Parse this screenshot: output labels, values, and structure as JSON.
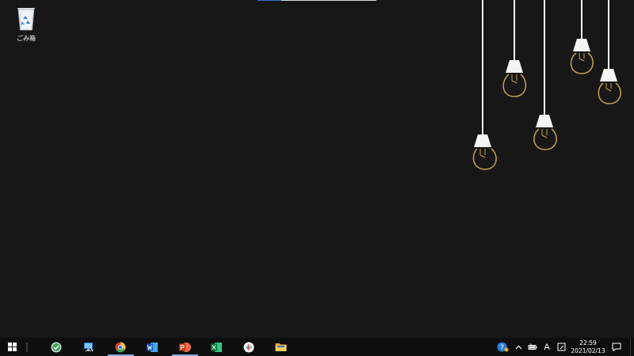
{
  "desktop": {
    "icons": [
      {
        "label": "ごみ箱",
        "icon": "recycle-bin-icon"
      }
    ]
  },
  "taskbar": {
    "start_icon": "windows-start-icon",
    "apps": [
      {
        "name": "Tasks",
        "icon": "green-check-icon",
        "active": false
      },
      {
        "name": "Remote Desktop",
        "icon": "remote-desktop-icon",
        "active": false
      },
      {
        "name": "Google Chrome",
        "icon": "chrome-icon",
        "active": true
      },
      {
        "name": "Word",
        "icon": "word-icon",
        "active": false
      },
      {
        "name": "PowerPoint",
        "icon": "powerpoint-icon",
        "active": true
      },
      {
        "name": "Excel",
        "icon": "excel-icon",
        "active": false
      },
      {
        "name": "Slack",
        "icon": "slack-icon",
        "active": false
      },
      {
        "name": "File Explorer",
        "icon": "file-explorer-icon",
        "active": false
      }
    ],
    "tray": {
      "ime_label": "A",
      "time": "22:59",
      "date": "2021/02/13"
    }
  },
  "colors": {
    "desktop_bg": "#171717",
    "taskbar_bg": "#0e0e0e",
    "active_indicator": "#7aa7e6",
    "bulb_filament": "#c9a24d"
  }
}
